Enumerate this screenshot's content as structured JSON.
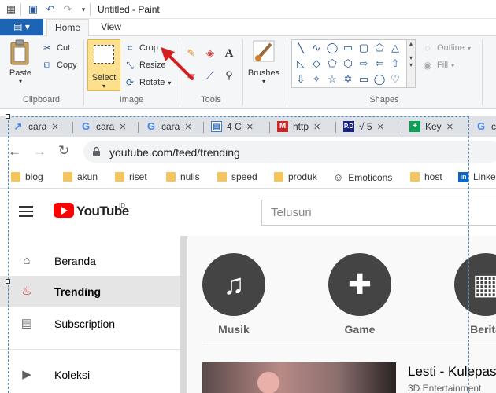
{
  "paint": {
    "window_title": "Untitled - Paint",
    "tabs": {
      "file": "▤ ▾",
      "home": "Home",
      "view": "View"
    },
    "clipboard": {
      "paste": "Paste",
      "cut": "Cut",
      "copy": "Copy",
      "group": "Clipboard"
    },
    "image": {
      "select": "Select",
      "crop": "Crop",
      "resize": "Resize",
      "rotate": "Rotate",
      "group": "Image"
    },
    "tools": {
      "group": "Tools"
    },
    "brushes": {
      "label": "Brushes"
    },
    "shapes": {
      "outline": "Outline",
      "fill": "Fill",
      "group": "Shapes"
    },
    "accent_color": "#1e64b4",
    "annotation_arrow_color": "#d21f1f"
  },
  "browser": {
    "tabs": [
      {
        "label": "cara",
        "icon": "trend-icon"
      },
      {
        "label": "cara",
        "icon": "google-icon"
      },
      {
        "label": "cara",
        "icon": "google-icon"
      },
      {
        "label": "4 C",
        "icon": "doc-icon"
      },
      {
        "label": "http",
        "icon": "m-icon"
      },
      {
        "label": "√ 5",
        "icon": "pd-icon"
      },
      {
        "label": "Key",
        "icon": "sheets-icon"
      },
      {
        "label": "c",
        "icon": "google-icon"
      }
    ],
    "url": "youtube.com/feed/trending",
    "bookmarks": [
      "blog",
      "akun",
      "riset",
      "nulis",
      "speed",
      "produk",
      "Emoticons",
      "host",
      "Linke"
    ]
  },
  "youtube": {
    "logo": "YouTube",
    "region": "ID",
    "search_placeholder": "Telusuri",
    "sidebar": [
      {
        "label": "Beranda",
        "icon": "home-icon",
        "active": false
      },
      {
        "label": "Trending",
        "icon": "fire-icon",
        "active": true
      },
      {
        "label": "Subscription",
        "icon": "subscriptions-icon",
        "active": false
      },
      {
        "label": "Koleksi",
        "icon": "library-icon",
        "active": false
      }
    ],
    "categories": [
      {
        "label": "Musik",
        "icon": "music-note-icon"
      },
      {
        "label": "Game",
        "icon": "gamepad-icon"
      },
      {
        "label": "Berita",
        "icon": "news-icon"
      }
    ],
    "video": {
      "title": "Lesti - Kulepas",
      "channel": "3D Entertainment"
    }
  }
}
